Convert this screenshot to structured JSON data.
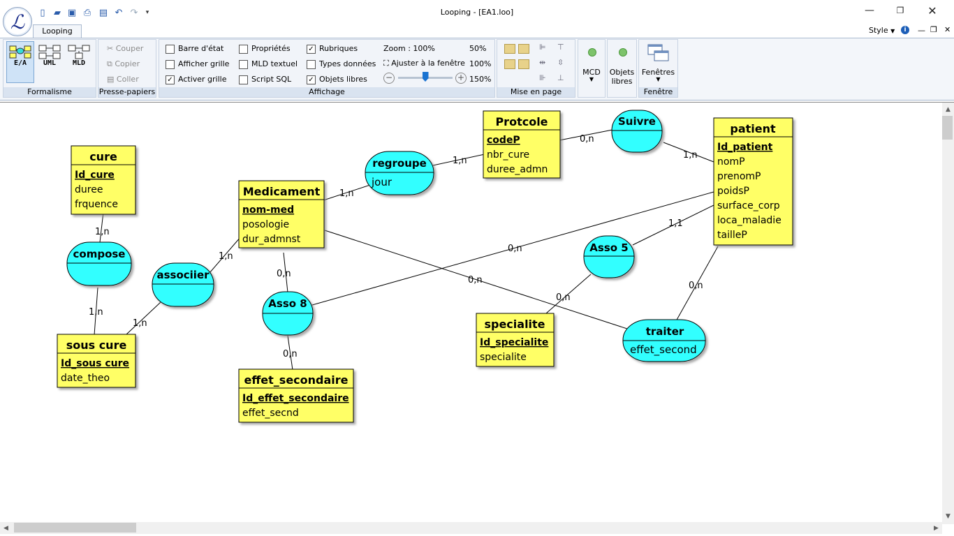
{
  "window": {
    "title": "Looping - [EA1.loo]",
    "style_label": "Style"
  },
  "tabs": {
    "main": "Looping"
  },
  "ribbon": {
    "formalisme": {
      "label": "Formalisme",
      "buttons": [
        "E/A",
        "UML",
        "MLD"
      ]
    },
    "presse": {
      "label": "Presse-papiers",
      "couper": "Couper",
      "copier": "Copier",
      "coller": "Coller"
    },
    "affichage": {
      "label": "Affichage",
      "barre_etat": "Barre d'état",
      "afficher_grille": "Afficher grille",
      "activer_grille": "Activer grille",
      "proprietes": "Propriétés",
      "mld_textuel": "MLD textuel",
      "script_sql": "Script SQL",
      "rubriques": "Rubriques",
      "types_donnees": "Types données",
      "objets_libres": "Objets libres",
      "zoom": "Zoom : 100%",
      "zoom_50": "50%",
      "ajuster": "Ajuster à la fenêtre",
      "zoom_100": "100%",
      "zoom_150": "150%",
      "zoom_level": 0.5
    },
    "mise_en_page": {
      "label": "Mise en page"
    },
    "mcd": {
      "label": "MCD"
    },
    "objets": {
      "label1": "Objets",
      "label2": "libres"
    },
    "fenetre": {
      "label": "Fenêtre",
      "button": "Fenêtres"
    }
  },
  "diagram": {
    "entities": [
      {
        "title": "cure",
        "key": "Id_cure",
        "attrs": [
          "duree",
          "frquence"
        ]
      },
      {
        "title": "Medicament",
        "key": "nom-med",
        "attrs": [
          "posologie",
          "dur_admnst"
        ]
      },
      {
        "title": "Protcole",
        "key": "codeP",
        "attrs": [
          "nbr_cure",
          "duree_admn"
        ]
      },
      {
        "title": "patient",
        "key": "Id_patient",
        "attrs": [
          "nomP",
          "prenomP",
          "poidsP",
          "surface_corp",
          "loca_maladie",
          "tailleP"
        ]
      },
      {
        "title": "sous cure",
        "key": "Id_sous cure",
        "attrs": [
          "date_theo"
        ]
      },
      {
        "title": "effet_secondaire",
        "key": "Id_effet_secondaire",
        "attrs": [
          "effet_secnd"
        ]
      },
      {
        "title": "specialite",
        "key": "Id_specialite",
        "attrs": [
          "specialite"
        ]
      }
    ],
    "associations": [
      {
        "name": "compose",
        "attr": ""
      },
      {
        "name": "associier",
        "attr": ""
      },
      {
        "name": "regroupe",
        "attr": "jour"
      },
      {
        "name": "Suivre",
        "attr": ""
      },
      {
        "name": "Asso 8",
        "attr": ""
      },
      {
        "name": "Asso 5",
        "attr": ""
      },
      {
        "name": "traiter",
        "attr": "effet_second"
      }
    ],
    "cardinalities": [
      "1,n",
      "1,n",
      "1,n",
      "1,n",
      "1,n",
      "1,n",
      "0,n",
      "1,n",
      "0,n",
      "0,n",
      "0,n",
      "1,1",
      "0,n",
      "0,n",
      "0,n"
    ]
  }
}
